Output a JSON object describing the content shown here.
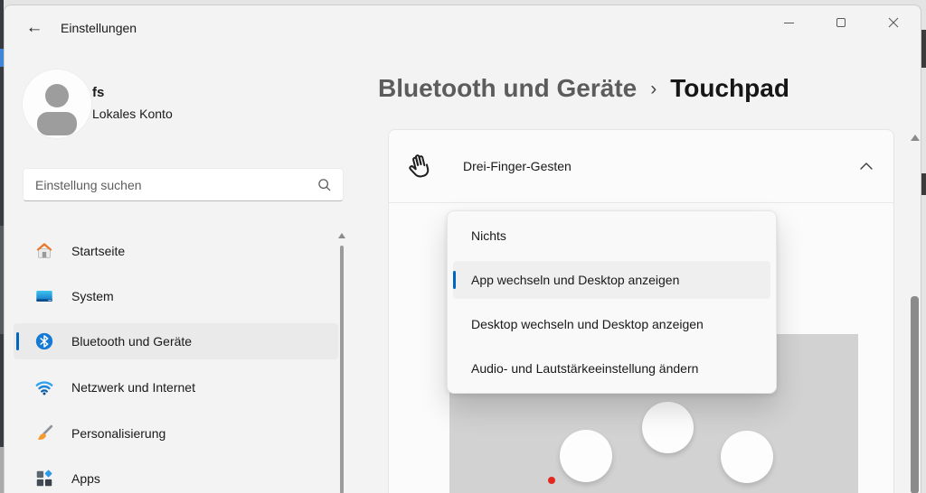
{
  "window": {
    "title": "Einstellungen",
    "icons": {
      "back": "←",
      "breadcrumb_separator": "›"
    }
  },
  "sidebar": {
    "user": {
      "name": "fs",
      "subtitle": "Lokales Konto"
    },
    "search_placeholder": "Einstellung suchen",
    "items": [
      {
        "label": "Startseite",
        "selected": false
      },
      {
        "label": "System",
        "selected": false
      },
      {
        "label": "Bluetooth und Geräte",
        "selected": true
      },
      {
        "label": "Netzwerk und Internet",
        "selected": false
      },
      {
        "label": "Personalisierung",
        "selected": false
      },
      {
        "label": "Apps",
        "selected": false
      }
    ]
  },
  "breadcrumb": {
    "parent": "Bluetooth und Geräte",
    "current": "Touchpad"
  },
  "content": {
    "section_title": "Drei-Finger-Gesten",
    "dropdown_options": [
      {
        "label": "Nichts",
        "selected": false
      },
      {
        "label": "App wechseln und Desktop anzeigen",
        "selected": true
      },
      {
        "label": "Desktop wechseln und Desktop anzeigen",
        "selected": false
      },
      {
        "label": "Audio- und Lautstärkeeinstellung ändern",
        "selected": false
      }
    ]
  },
  "colors": {
    "accent": "#0067c0",
    "red_dot": "#e3281e",
    "touchpad_bg": "#d2d2d2"
  }
}
